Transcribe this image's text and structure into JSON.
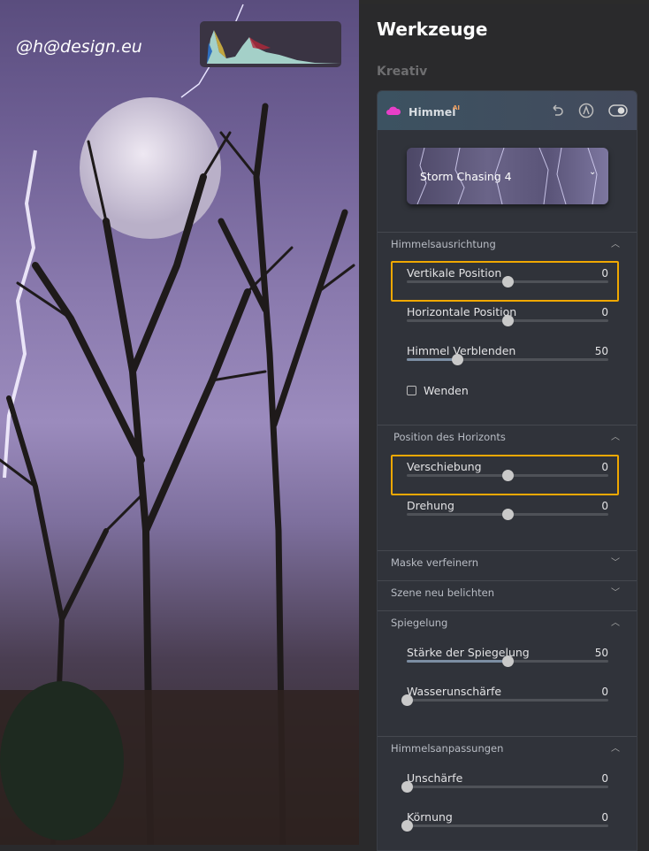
{
  "photo": {
    "watermark": "@h@design.eu"
  },
  "panel": {
    "title": "Werkzeuge",
    "category": "Kreativ",
    "tool": {
      "name": "Himmel",
      "badge": "AI",
      "icon": "cloud-icon",
      "icon_color": "#e83fc8"
    },
    "preset": {
      "name": "Storm Chasing 4"
    },
    "sections": [
      {
        "title": "Himmelsausrichtung",
        "expanded": true
      },
      {
        "title": "Position des Horizonts",
        "expanded": true
      },
      {
        "title": "Maske verfeinern",
        "expanded": false
      },
      {
        "title": "Szene neu belichten",
        "expanded": false
      },
      {
        "title": "Spiegelung",
        "expanded": true
      },
      {
        "title": "Himmelsanpassungen",
        "expanded": true
      }
    ],
    "sliders": [
      {
        "label": "Vertikale Position",
        "value": "0",
        "min": -100,
        "max": 100,
        "highlighted": true
      },
      {
        "label": "Horizontale Position",
        "value": "0",
        "min": -100,
        "max": 100
      },
      {
        "label": "Himmel Verblenden",
        "value": "50",
        "min": 0,
        "max": 200
      },
      {
        "label": "Verschiebung",
        "value": "0",
        "min": -100,
        "max": 100,
        "highlighted": true
      },
      {
        "label": "Drehung",
        "value": "0",
        "min": -100,
        "max": 100
      },
      {
        "label": "Stärke der Spiegelung",
        "value": "50",
        "min": 0,
        "max": 100
      },
      {
        "label": "Wasserunschärfe",
        "value": "0",
        "min": 0,
        "max": 100
      },
      {
        "label": "Unschärfe",
        "value": "0",
        "min": 0,
        "max": 100
      },
      {
        "label": "Körnung",
        "value": "0",
        "min": 0,
        "max": 100
      }
    ],
    "checkbox": {
      "label": "Wenden",
      "checked": false
    },
    "highlight_color": "#f0a800"
  }
}
